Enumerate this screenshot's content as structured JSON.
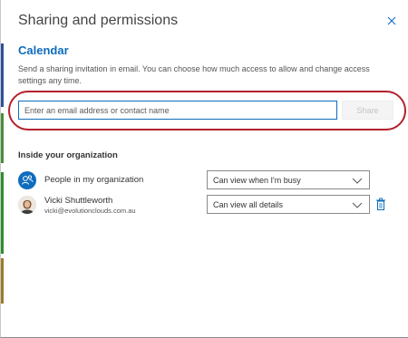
{
  "dialog": {
    "title": "Sharing and permissions",
    "calendar_name": "Calendar",
    "description": "Send a sharing invitation in email. You can choose how much access to allow and change access settings any time."
  },
  "invite": {
    "placeholder": "Enter an email address or contact name",
    "share_label": "Share"
  },
  "organization": {
    "header": "Inside your organization",
    "members": [
      {
        "name": "People in my organization",
        "email": "",
        "permission": "Can view when I'm busy",
        "icon": "people-org-icon"
      },
      {
        "name": "Vicki Shuttleworth",
        "email": "vicki@evolutionclouds.com.au",
        "permission": "Can view all details",
        "icon": "avatar-photo"
      }
    ]
  },
  "colors": {
    "accent": "#0f6cbd",
    "highlight": "#b3202c"
  }
}
